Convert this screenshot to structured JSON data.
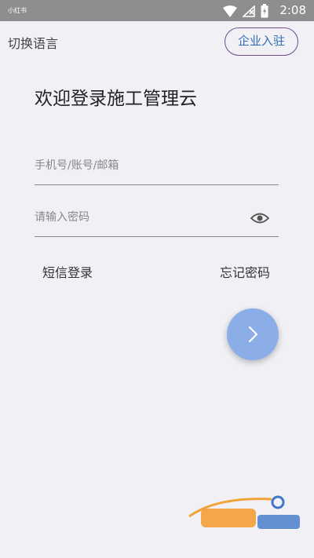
{
  "status_bar": {
    "carrier": "小红书",
    "time": "2:08"
  },
  "header": {
    "language_label": "切换语言",
    "enterprise_label": "企业入驻"
  },
  "welcome_title": "欢迎登录施工管理云",
  "form": {
    "account_placeholder": "手机号/账号/邮箱",
    "account_value": "",
    "password_placeholder": "请输入密码",
    "password_value": ""
  },
  "links": {
    "sms_login": "短信登录",
    "forgot_password": "忘记密码"
  },
  "colors": {
    "background": "#f1f0f5",
    "accent_button": "#8caee8",
    "enterprise_border": "#6b4e8f",
    "enterprise_text": "#2f6fb8"
  }
}
